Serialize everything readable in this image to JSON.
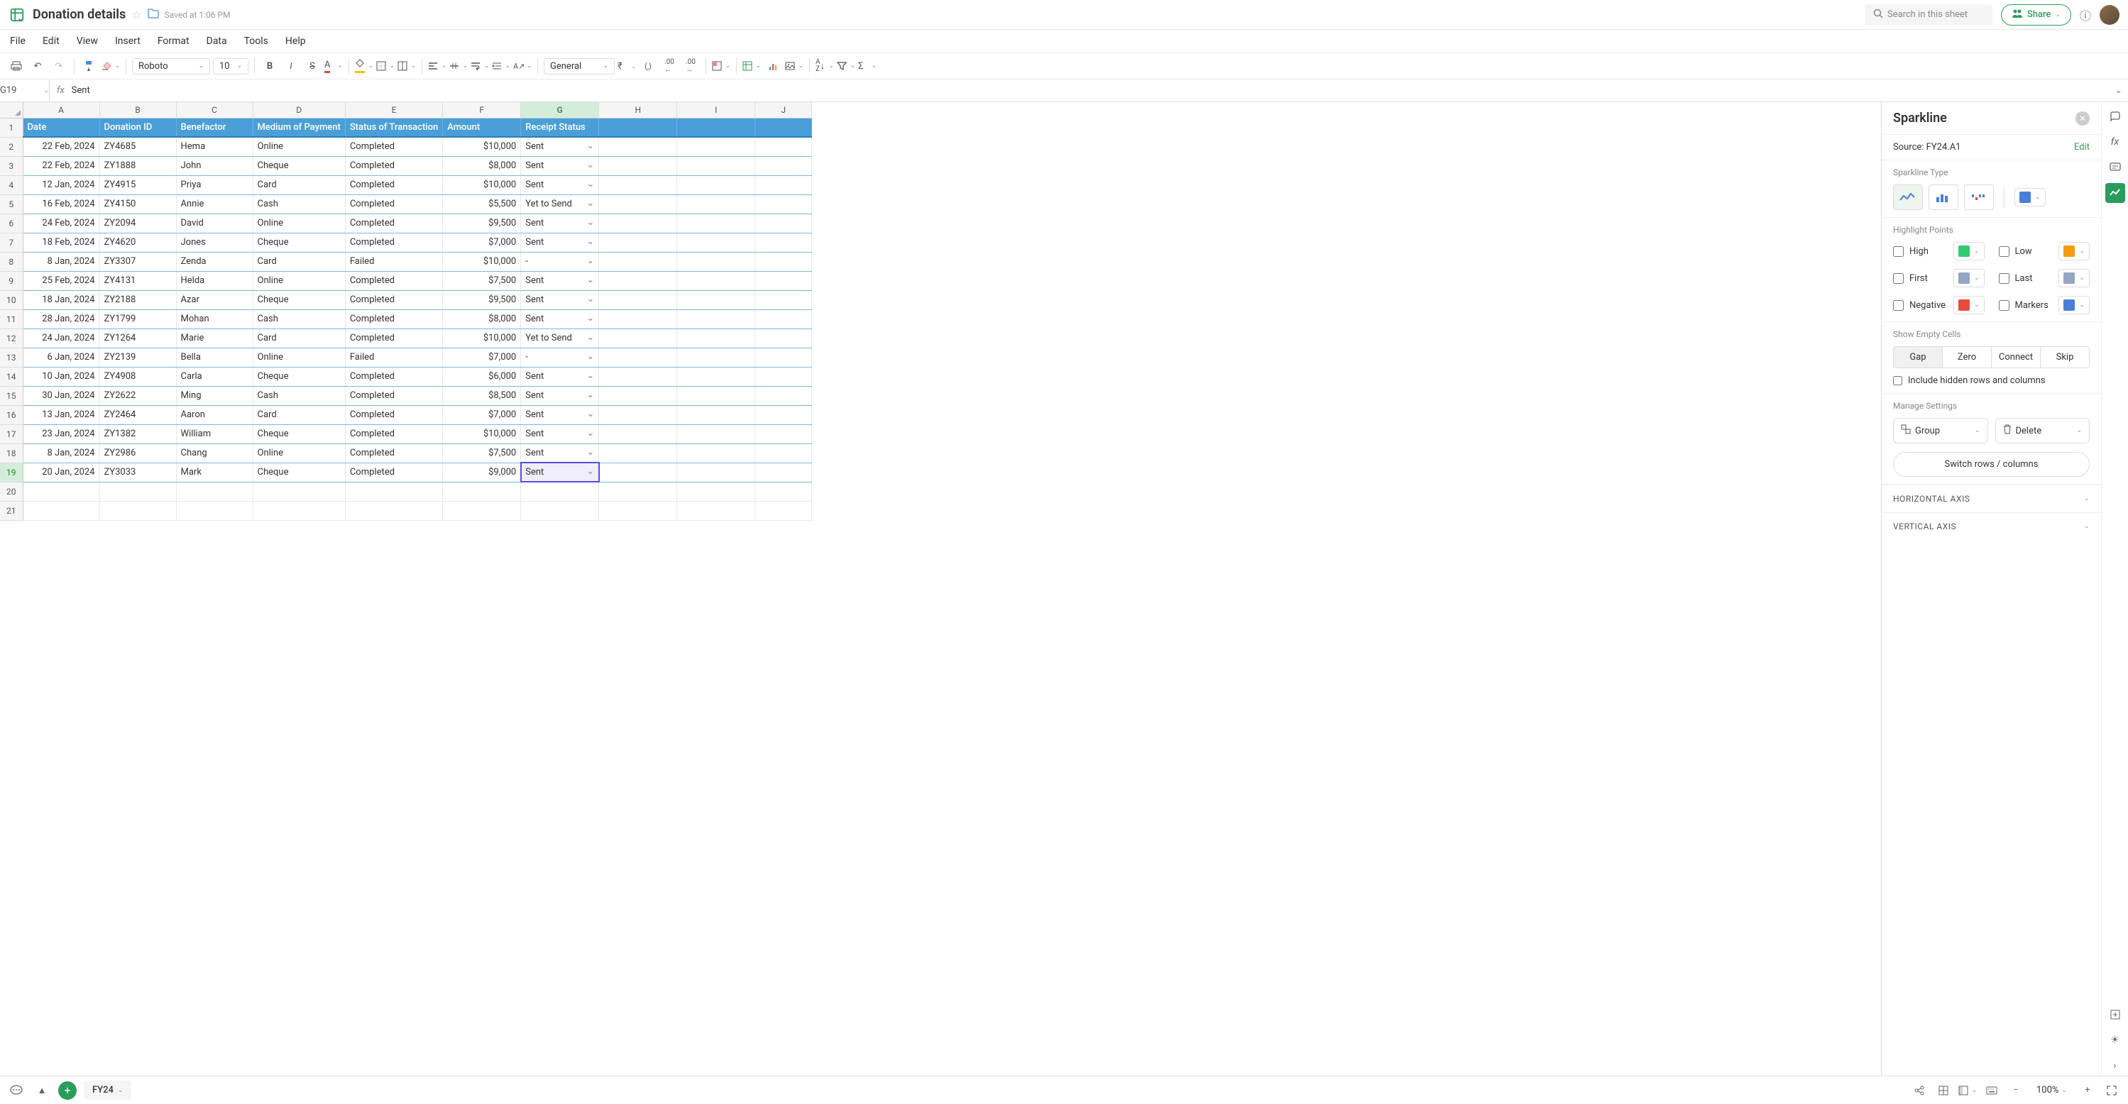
{
  "topbar": {
    "title": "Donation details",
    "saved": "Saved at 1:06 PM",
    "search_placeholder": "Search in this sheet",
    "share": "Share"
  },
  "menu": [
    "File",
    "Edit",
    "View",
    "Insert",
    "Format",
    "Data",
    "Tools",
    "Help"
  ],
  "toolbar": {
    "font": "Roboto",
    "size": "10",
    "number_format": "General"
  },
  "formula_bar": {
    "cell_ref": "G19",
    "fx": "fx",
    "value": "Sent"
  },
  "columns": [
    "A",
    "B",
    "C",
    "D",
    "E",
    "F",
    "G",
    "H",
    "I",
    "J"
  ],
  "headers": [
    "Date",
    "Donation ID",
    "Benefactor",
    "Medium of Payment",
    "Status of Transaction",
    "Amount",
    "Receipt Status"
  ],
  "rows": [
    {
      "date": "22 Feb, 2024",
      "id": "ZY4685",
      "ben": "Hema",
      "med": "Online",
      "status": "Completed",
      "amt": "$10,000",
      "rec": "Sent"
    },
    {
      "date": "22 Feb, 2024",
      "id": "ZY1888",
      "ben": "John",
      "med": "Cheque",
      "status": "Completed",
      "amt": "$8,000",
      "rec": "Sent"
    },
    {
      "date": "12 Jan, 2024",
      "id": "ZY4915",
      "ben": "Priya",
      "med": "Card",
      "status": "Completed",
      "amt": "$10,000",
      "rec": "Sent"
    },
    {
      "date": "16 Feb, 2024",
      "id": "ZY4150",
      "ben": "Annie",
      "med": "Cash",
      "status": "Completed",
      "amt": "$5,500",
      "rec": "Yet to Send"
    },
    {
      "date": "24 Feb, 2024",
      "id": "ZY2094",
      "ben": "David",
      "med": "Online",
      "status": "Completed",
      "amt": "$9,500",
      "rec": "Sent"
    },
    {
      "date": "18 Feb, 2024",
      "id": "ZY4620",
      "ben": "Jones",
      "med": "Cheque",
      "status": "Completed",
      "amt": "$7,000",
      "rec": "Sent"
    },
    {
      "date": "8 Jan, 2024",
      "id": "ZY3307",
      "ben": "Zenda",
      "med": "Card",
      "status": "Failed",
      "amt": "$10,000",
      "rec": "-"
    },
    {
      "date": "25 Feb, 2024",
      "id": "ZY4131",
      "ben": "Helda",
      "med": "Online",
      "status": "Completed",
      "amt": "$7,500",
      "rec": "Sent"
    },
    {
      "date": "18 Jan, 2024",
      "id": "ZY2188",
      "ben": "Azar",
      "med": "Cheque",
      "status": "Completed",
      "amt": "$9,500",
      "rec": "Sent"
    },
    {
      "date": "28 Jan, 2024",
      "id": "ZY1799",
      "ben": "Mohan",
      "med": "Cash",
      "status": "Completed",
      "amt": "$8,000",
      "rec": "Sent"
    },
    {
      "date": "24 Jan, 2024",
      "id": "ZY1264",
      "ben": "Marie",
      "med": "Card",
      "status": "Completed",
      "amt": "$10,000",
      "rec": "Yet to Send"
    },
    {
      "date": "6 Jan, 2024",
      "id": "ZY2139",
      "ben": "Bella",
      "med": "Online",
      "status": "Failed",
      "amt": "$7,000",
      "rec": "-"
    },
    {
      "date": "10 Jan, 2024",
      "id": "ZY4908",
      "ben": "Carla",
      "med": "Cheque",
      "status": "Completed",
      "amt": "$6,000",
      "rec": "Sent"
    },
    {
      "date": "30 Jan, 2024",
      "id": "ZY2622",
      "ben": "Ming",
      "med": "Cash",
      "status": "Completed",
      "amt": "$8,500",
      "rec": "Sent"
    },
    {
      "date": "13 Jan, 2024",
      "id": "ZY2464",
      "ben": "Aaron",
      "med": "Card",
      "status": "Completed",
      "amt": "$7,000",
      "rec": "Sent"
    },
    {
      "date": "23 Jan, 2024",
      "id": "ZY1382",
      "ben": "William",
      "med": "Cheque",
      "status": "Completed",
      "amt": "$10,000",
      "rec": "Sent"
    },
    {
      "date": "8 Jan, 2024",
      "id": "ZY2986",
      "ben": "Chang",
      "med": "Online",
      "status": "Completed",
      "amt": "$7,500",
      "rec": "Sent"
    },
    {
      "date": "20 Jan, 2024",
      "id": "ZY3033",
      "ben": "Mark",
      "med": "Cheque",
      "status": "Completed",
      "amt": "$9,000",
      "rec": "Sent"
    }
  ],
  "selected_row": 19,
  "panel": {
    "title": "Sparkline",
    "source_label": "Source: FY24.A1",
    "edit": "Edit",
    "type_label": "Sparkline Type",
    "highlight_label": "Highlight Points",
    "highlights": {
      "high": "High",
      "low": "Low",
      "first": "First",
      "last": "Last",
      "negative": "Negative",
      "markers": "Markers"
    },
    "colors": {
      "main": "#4a7fd8",
      "high": "#2ecc71",
      "low": "#f39c12",
      "first": "#95a5c6",
      "last": "#95a5c6",
      "negative": "#e74c3c",
      "markers": "#4a7fd8"
    },
    "empty_label": "Show Empty Cells",
    "empty_opts": [
      "Gap",
      "Zero",
      "Connect",
      "Skip"
    ],
    "include_hidden": "Include hidden rows and columns",
    "manage_label": "Manage Settings",
    "group": "Group",
    "delete": "Delete",
    "switch": "Switch rows / columns",
    "h_axis": "HORIZONTAL AXIS",
    "v_axis": "VERTICAL AXIS"
  },
  "bottom": {
    "sheet": "FY24",
    "zoom": "100%"
  }
}
